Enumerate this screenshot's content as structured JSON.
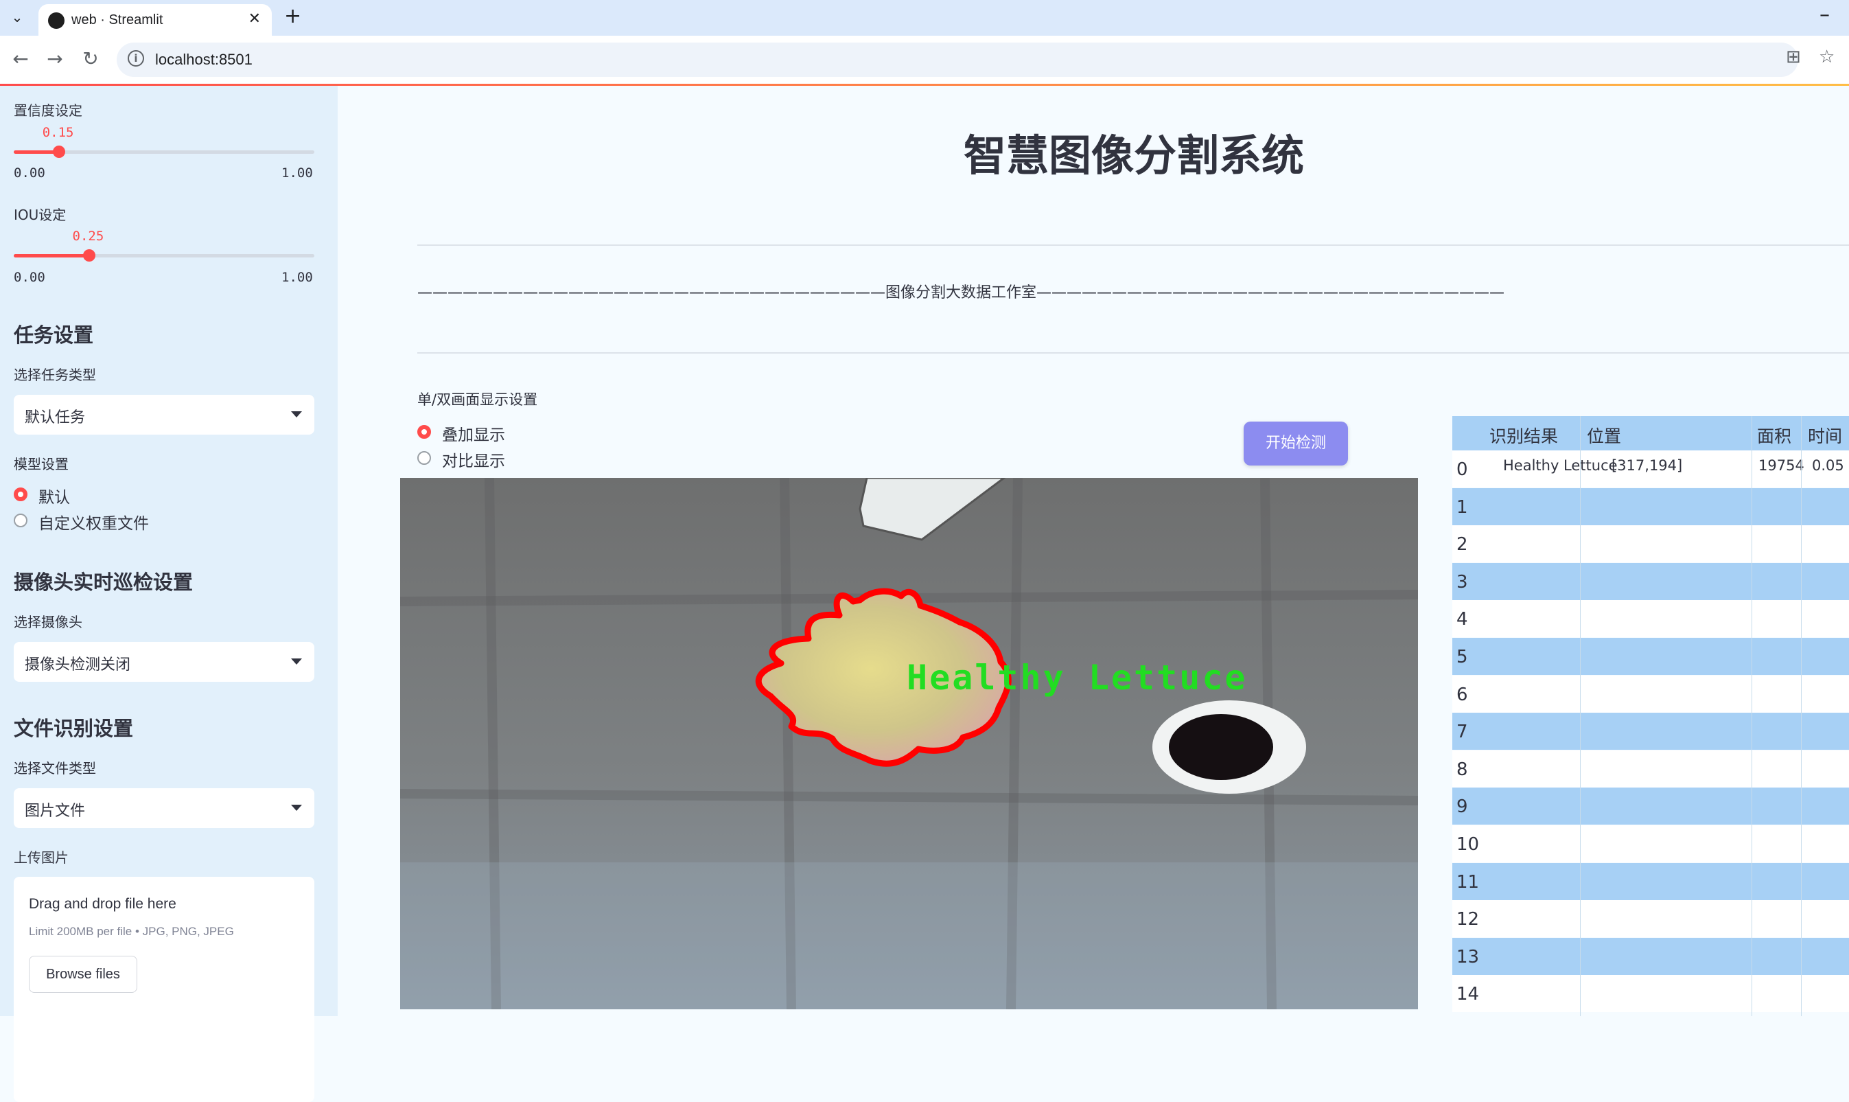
{
  "browser": {
    "tab_title": "web · Streamlit",
    "url": "localhost:8501"
  },
  "sidebar": {
    "confidence": {
      "label": "置信度设定",
      "value": "0.15",
      "min": "0.00",
      "max": "1.00",
      "level": 0.15
    },
    "iou": {
      "label": "IOU设定",
      "value": "0.25",
      "min": "0.00",
      "max": "1.00",
      "level": 0.25
    },
    "task_heading": "任务设置",
    "task_type_label": "选择任务类型",
    "task_type_value": "默认任务",
    "model_label": "模型设置",
    "model_options": [
      "默认",
      "自定义权重文件"
    ],
    "model_selected": 0,
    "camera_heading": "摄像头实时巡检设置",
    "camera_label": "选择摄像头",
    "camera_value": "摄像头检测关闭",
    "file_heading": "文件识别设置",
    "file_type_label": "选择文件类型",
    "file_type_value": "图片文件",
    "upload_label": "上传图片",
    "upload_drop": "Drag and drop file here",
    "upload_limit": "Limit 200MB per file • JPG, PNG, JPEG",
    "upload_button": "Browse files"
  },
  "main": {
    "title": "智慧图像分割系统",
    "banner": "———————————————————————————————图像分割大数据工作室———————————————————————————————",
    "display_mode_label": "单/双画面显示设置",
    "display_options": [
      "叠加显示",
      "对比显示"
    ],
    "display_selected": 0,
    "start_button": "开始检测",
    "detection_label": "Healthy Lettuce"
  },
  "results_table": {
    "columns": [
      "识别结果",
      "位置",
      "面积",
      "时间"
    ],
    "rows": [
      {
        "index": "0",
        "result": "Healthy Lettuce",
        "position": "[317,194]",
        "area": "19754",
        "time": "0.05"
      },
      {
        "index": "1"
      },
      {
        "index": "2"
      },
      {
        "index": "3"
      },
      {
        "index": "4"
      },
      {
        "index": "5"
      },
      {
        "index": "6"
      },
      {
        "index": "7"
      },
      {
        "index": "8"
      },
      {
        "index": "9"
      },
      {
        "index": "10"
      },
      {
        "index": "11"
      },
      {
        "index": "12"
      },
      {
        "index": "13"
      },
      {
        "index": "14"
      }
    ]
  },
  "colors": {
    "accent": "#ff4b4b",
    "sidebar_bg": "#e2f0fb",
    "table_stripe": "#a7d0f5",
    "button": "#8c8cf0",
    "mask_outline": "#ff0000",
    "label_text": "#22dd22"
  }
}
